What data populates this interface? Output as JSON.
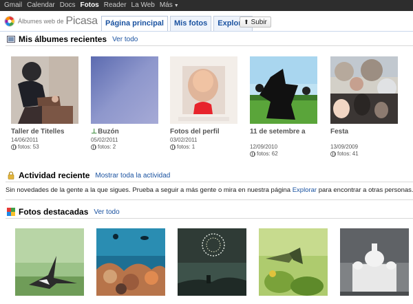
{
  "gbar": {
    "items": [
      "Gmail",
      "Calendar",
      "Docs",
      "Fotos",
      "Reader",
      "La Web",
      "Más"
    ],
    "active": "Fotos"
  },
  "header": {
    "logo_prefix": "Álbumes web de",
    "logo_brand": "Picasa",
    "tabs": [
      "Página principal",
      "Mis fotos",
      "Explorar"
    ],
    "upload_label": "Subir"
  },
  "recent_albums": {
    "title": "Mis álbumes recientes",
    "link": "Ver todo",
    "items": [
      {
        "name": "Taller de Titelles",
        "date": "14/06/2011",
        "count": "fotos: 53"
      },
      {
        "name": "Buzón",
        "date": "05/02/2011",
        "count": "fotos: 2"
      },
      {
        "name": "Fotos del perfil",
        "date": "03/02/2011",
        "count": "fotos: 1"
      },
      {
        "name": "11 de setembre a",
        "date": "12/09/2010",
        "count": "fotos: 62"
      },
      {
        "name": "Festa",
        "date": "13/09/2009",
        "count": "fotos: 41"
      }
    ]
  },
  "activity": {
    "title": "Actividad reciente",
    "link": "Mostrar toda la actividad",
    "text_before": "Sin novedades de la gente a la que sigues. Prueba a seguir a más gente o mira en nuestra página",
    "text_link": "Explorar",
    "text_after": "para encontrar a otras personas."
  },
  "featured": {
    "title": "Fotos destacadas",
    "link": "Ver todo"
  },
  "colors": {
    "link": "#1a52a0",
    "gbar_bg": "#2d2d2d",
    "tab_bg": "#eef3fb"
  }
}
